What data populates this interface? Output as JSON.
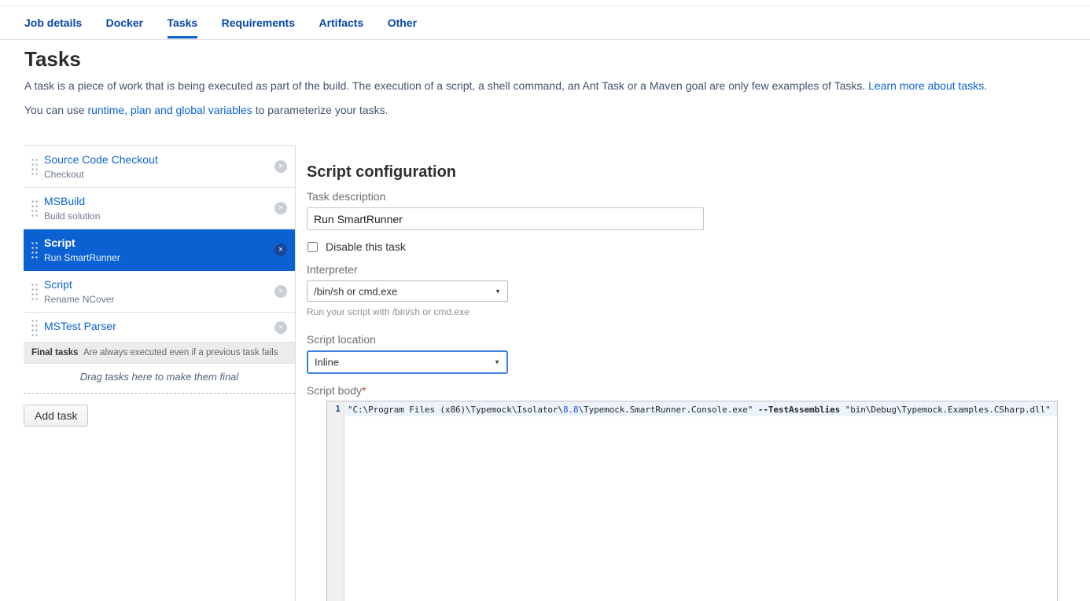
{
  "icons": {
    "delete": "✕",
    "dropdown_arrow": "▼"
  },
  "colors": {
    "accent_blue": "#0b63ce",
    "tab_blue": "#0747a6",
    "selected_task_bg": "#0b61d2",
    "required_red": "#d0453a",
    "number_token_blue": "#1a56db"
  },
  "tabs": {
    "active": "Tasks",
    "items": [
      {
        "label": "Job details"
      },
      {
        "label": "Docker"
      },
      {
        "label": "Tasks"
      },
      {
        "label": "Requirements"
      },
      {
        "label": "Artifacts"
      },
      {
        "label": "Other"
      }
    ]
  },
  "page": {
    "title": "Tasks",
    "intro_text": "A task is a piece of work that is being executed as part of the build. The execution of a script, a shell command, an Ant Task or a Maven goal are only few examples of Tasks.",
    "intro_link_text": "Learn more about tasks.",
    "variables_prefix": "You can use",
    "variables_link_text": "runtime, plan and global variables",
    "variables_suffix": "to parameterize your tasks."
  },
  "task_list": {
    "items": [
      {
        "title": "Source Code Checkout",
        "subtitle": "Checkout",
        "selected": false
      },
      {
        "title": "MSBuild",
        "subtitle": "Build solution",
        "selected": false
      },
      {
        "title": "Script",
        "subtitle": "Run SmartRunner",
        "selected": true
      },
      {
        "title": "Script",
        "subtitle": "Rename NCover",
        "selected": false
      },
      {
        "title": "MSTest Parser",
        "subtitle": "",
        "selected": false
      }
    ],
    "final_tasks_label": "Final tasks",
    "final_tasks_desc": "Are always executed even if a previous task fails",
    "drop_hint": "Drag tasks here to make them final",
    "add_task_label": "Add task"
  },
  "config": {
    "title": "Script configuration",
    "task_description_label": "Task description",
    "task_description_value": "Run SmartRunner",
    "disable_label": "Disable this task",
    "disable_checked": false,
    "interpreter_label": "Interpreter",
    "interpreter_value": "/bin/sh or cmd.exe",
    "interpreter_help": "Run your script with /bin/sh or cmd.exe",
    "script_location_label": "Script location",
    "script_location_value": "Inline",
    "script_body_label": "Script body",
    "required_marker": "*",
    "editor": {
      "line_number": "1",
      "code_text": "\"C:\\Program Files (x86)\\Typemock\\Isolator\\8.8\\Typemock.SmartRunner.Console.exe\" --TestAssemblies \"bin\\Debug\\Typemock.Examples.CSharp.dll\"",
      "segments": [
        {
          "text": "\"C:\\Program Files (x86)\\Typemock\\Isolator\\",
          "color": "#24292e",
          "bold": false
        },
        {
          "text": "8.8",
          "color": "#1a56db",
          "bold": false
        },
        {
          "text": "\\Typemock.SmartRunner.Console.exe\" ",
          "color": "#24292e",
          "bold": false
        },
        {
          "text": "--TestAssemblies",
          "color": "#24292e",
          "bold": true
        },
        {
          "text": " \"bin\\Debug\\Typemock.Examples.CSharp.dll\"",
          "color": "#24292e",
          "bold": false
        }
      ]
    }
  }
}
